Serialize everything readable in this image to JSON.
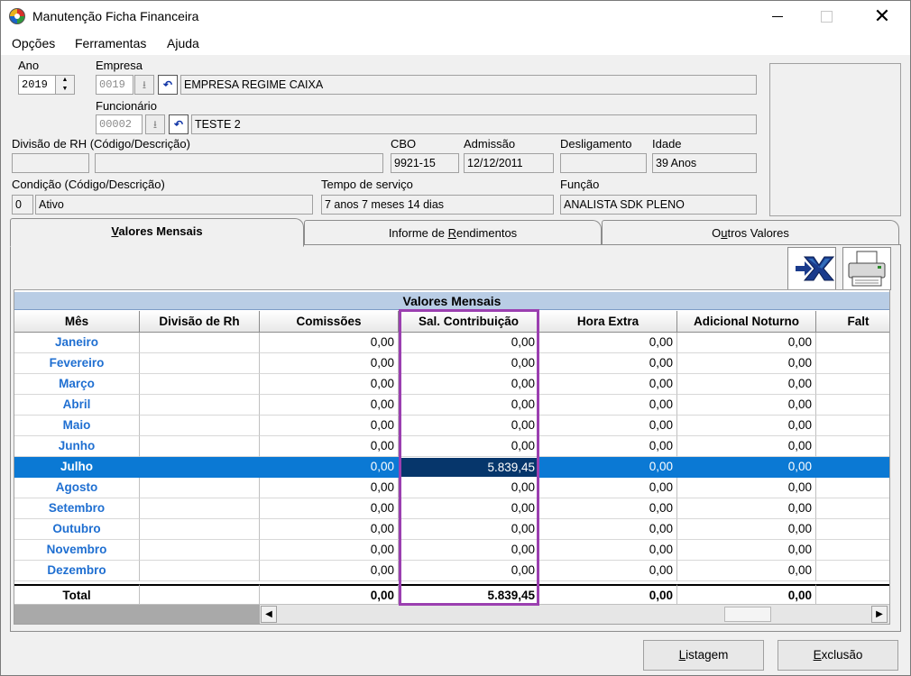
{
  "window": {
    "title": "Manutenção Ficha Financeira"
  },
  "menu": [
    "Opções",
    "Ferramentas",
    "Ajuda"
  ],
  "header": {
    "ano_label": "Ano",
    "ano_value": "2019",
    "empresa_label": "Empresa",
    "empresa_code": "0019",
    "empresa_name": "EMPRESA REGIME CAIXA",
    "funcionario_label": "Funcionário",
    "funcionario_code": "00002",
    "funcionario_name": "TESTE 2",
    "divisao_label": "Divisão de RH (Código/Descrição)",
    "divisao_code": "",
    "divisao_desc": "",
    "cbo_label": "CBO",
    "cbo_value": "9921-15",
    "admissao_label": "Admissão",
    "admissao_value": "12/12/2011",
    "desligamento_label": "Desligamento",
    "desligamento_value": "",
    "idade_label": "Idade",
    "idade_value": "39 Anos",
    "condicao_label": "Condição (Código/Descrição)",
    "condicao_code": "0",
    "condicao_desc": "Ativo",
    "tempo_label": "Tempo de serviço",
    "tempo_value": "7 anos 7 meses 14 dias",
    "funcao_label": "Função",
    "funcao_value": "ANALISTA SDK PLENO"
  },
  "tabs": [
    {
      "pre": "",
      "hot": "V",
      "post": "alores Mensais"
    },
    {
      "pre": "Informe de ",
      "hot": "R",
      "post": "endimentos"
    },
    {
      "pre": "O",
      "hot": "u",
      "post": "tros Valores"
    }
  ],
  "grid": {
    "title": "Valores Mensais",
    "columns": [
      "Mês",
      "Divisão de Rh",
      "Comissões",
      "Sal. Contribuição",
      "Hora Extra",
      "Adicional Noturno",
      "Falt"
    ],
    "rows": [
      {
        "mes": "Janeiro",
        "div": "",
        "com": "0,00",
        "sal": "0,00",
        "he": "0,00",
        "an": "0,00"
      },
      {
        "mes": "Fevereiro",
        "div": "",
        "com": "0,00",
        "sal": "0,00",
        "he": "0,00",
        "an": "0,00"
      },
      {
        "mes": "Março",
        "div": "",
        "com": "0,00",
        "sal": "0,00",
        "he": "0,00",
        "an": "0,00"
      },
      {
        "mes": "Abril",
        "div": "",
        "com": "0,00",
        "sal": "0,00",
        "he": "0,00",
        "an": "0,00"
      },
      {
        "mes": "Maio",
        "div": "",
        "com": "0,00",
        "sal": "0,00",
        "he": "0,00",
        "an": "0,00"
      },
      {
        "mes": "Junho",
        "div": "",
        "com": "0,00",
        "sal": "0,00",
        "he": "0,00",
        "an": "0,00"
      },
      {
        "mes": "Julho",
        "div": "",
        "com": "0,00",
        "sal": "5.839,45",
        "he": "0,00",
        "an": "0,00"
      },
      {
        "mes": "Agosto",
        "div": "",
        "com": "0,00",
        "sal": "0,00",
        "he": "0,00",
        "an": "0,00"
      },
      {
        "mes": "Setembro",
        "div": "",
        "com": "0,00",
        "sal": "0,00",
        "he": "0,00",
        "an": "0,00"
      },
      {
        "mes": "Outubro",
        "div": "",
        "com": "0,00",
        "sal": "0,00",
        "he": "0,00",
        "an": "0,00"
      },
      {
        "mes": "Novembro",
        "div": "",
        "com": "0,00",
        "sal": "0,00",
        "he": "0,00",
        "an": "0,00"
      },
      {
        "mes": "Dezembro",
        "div": "",
        "com": "0,00",
        "sal": "0,00",
        "he": "0,00",
        "an": "0,00"
      }
    ],
    "total": {
      "mes": "Total",
      "div": "",
      "com": "0,00",
      "sal": "5.839,45",
      "he": "0,00",
      "an": "0,00"
    }
  },
  "toolbar": {
    "excel_icon": "excel-export-icon",
    "print_icon": "printer-icon"
  },
  "buttons": {
    "listagem": {
      "pre": "",
      "hot": "L",
      "post": "istagem"
    },
    "exclusao": {
      "pre": "",
      "hot": "E",
      "post": "xclusão"
    }
  },
  "colors": {
    "selected_row": "#0b79d4",
    "month_text": "#1f6fd1",
    "highlight_box": "#9b3fb0",
    "grid_title_bg": "#b9cde5"
  }
}
